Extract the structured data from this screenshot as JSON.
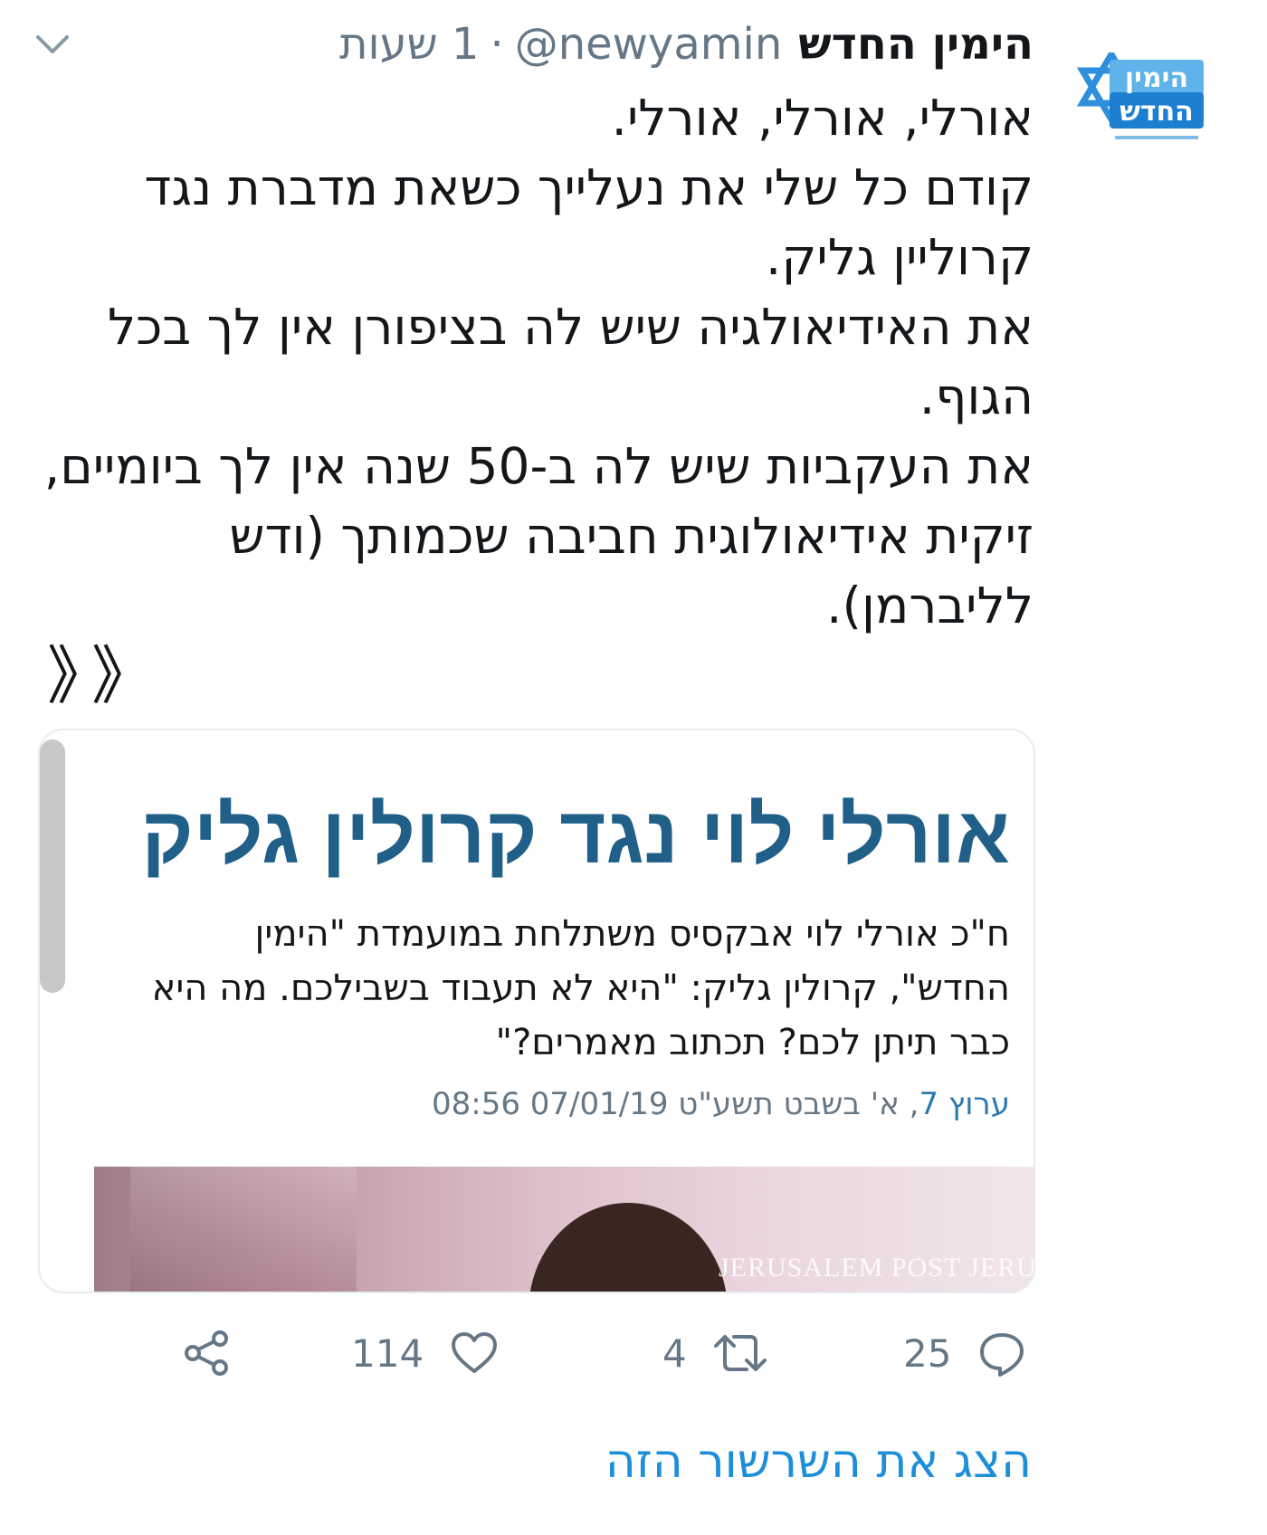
{
  "tweet": {
    "display_name": "הימין החדש",
    "handle": "@newyamin",
    "separator": "·",
    "time": "1 שעות",
    "text_lines": [
      "אורלי, אורלי, אורלי.",
      "קודם כל שלי את נעלייך כשאת מדברת נגד קרוליין גליק.",
      "את האידיאולגיה שיש לה בציפורן אין לך בכל הגוף.",
      "את העקביות שיש לה ב-50 שנה אין לך ביומיים, זיקית אידיאולוגית חביבה שכמותך (ודש לליברמן)."
    ],
    "chevrons": "》》"
  },
  "avatar": {
    "logo_line1": "הימין",
    "logo_line2": "החדש",
    "colors": {
      "blue": "#1c7fd0",
      "light_blue": "#5fb3ea",
      "star": "#2e8fdc"
    }
  },
  "card": {
    "title": "אורלי לוי נגד קרולין גליק",
    "description": "ח\"כ אורלי לוי אבקסיס משתלחת במועמדת \"הימין החדש\", קרולין גליק: \"היא לא תעבוד בשבילכם. מה היא כבר תיתן לכם? תכתוב מאמרים?\"",
    "source": "ערוץ 7",
    "date_text": ", א' בשבט תשע\"ט 07/01/19 08:56",
    "image_watermark": "JERUSALEM POST   JERUSA"
  },
  "actions": {
    "reply_count": "25",
    "retweet_count": "4",
    "like_count": "114"
  },
  "show_thread": "הצג את השרשור הזה",
  "colors": {
    "text": "#14171a",
    "secondary": "#657786",
    "link": "#1d8fd8",
    "card_title": "#1f5f88"
  },
  "icons": [
    "caret-down-icon",
    "reply-icon",
    "retweet-icon",
    "like-icon",
    "share-icon"
  ]
}
